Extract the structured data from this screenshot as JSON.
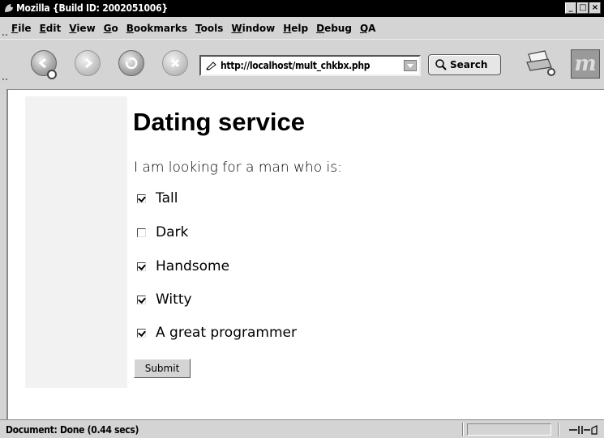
{
  "window": {
    "title": "Mozilla {Build ID: 2002051006}",
    "controls": [
      "_",
      "□",
      "×"
    ]
  },
  "menu": {
    "items": [
      {
        "accel": "F",
        "rest": "ile"
      },
      {
        "accel": "E",
        "rest": "dit"
      },
      {
        "accel": "V",
        "rest": "iew"
      },
      {
        "accel": "G",
        "rest": "o"
      },
      {
        "accel": "B",
        "rest": "ookmarks"
      },
      {
        "accel": "T",
        "rest": "ools"
      },
      {
        "accel": "W",
        "rest": "indow"
      },
      {
        "accel": "H",
        "rest": "elp"
      },
      {
        "accel": "D",
        "rest": "ebug"
      },
      {
        "accel": "Q",
        "rest": "A"
      }
    ]
  },
  "toolbar": {
    "url": "http://localhost/mult_chkbx.php",
    "search_label": "Search",
    "throbber_letter": "m",
    "icons": [
      "back-icon",
      "forward-icon",
      "reload-icon",
      "stop-icon",
      "print-icon"
    ]
  },
  "page": {
    "heading": "Dating service",
    "prompt": "I am looking for a man who is:",
    "options": [
      {
        "label": "Tall",
        "checked": true
      },
      {
        "label": "Dark",
        "checked": false
      },
      {
        "label": "Handsome",
        "checked": true
      },
      {
        "label": "Witty",
        "checked": true
      },
      {
        "label": "A great programmer",
        "checked": true
      }
    ],
    "submit_label": "Submit"
  },
  "status": {
    "text": "Document: Done (0.44 secs)"
  }
}
